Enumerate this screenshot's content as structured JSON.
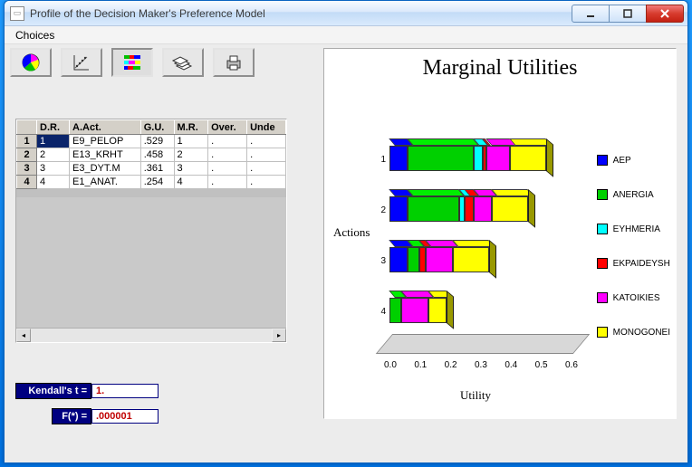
{
  "window": {
    "title": "Profile of the Decision Maker's Preference Model"
  },
  "menubar": {
    "choices": "Choices"
  },
  "toolbar": {
    "icons": [
      "pie-chart-icon",
      "scatter-icon",
      "stacked-bar-icon",
      "layers-icon",
      "print-icon"
    ]
  },
  "table": {
    "headers": [
      "D.R.",
      "A.Act.",
      "G.U.",
      "M.R.",
      "Over.",
      "Unde"
    ],
    "rows": [
      {
        "n": "1",
        "dr": "1",
        "act": "E9_PELOP",
        "gu": ".529",
        "mr": "1",
        "over": ".",
        "unde": "."
      },
      {
        "n": "2",
        "dr": "2",
        "act": "E13_KRHT",
        "gu": ".458",
        "mr": "2",
        "over": ".",
        "unde": "."
      },
      {
        "n": "3",
        "dr": "3",
        "act": "E3_DYT.M",
        "gu": ".361",
        "mr": "3",
        "over": ".",
        "unde": "."
      },
      {
        "n": "4",
        "dr": "4",
        "act": "E1_ANAT.",
        "gu": ".254",
        "mr": "4",
        "over": ".",
        "unde": "."
      }
    ]
  },
  "fields": {
    "kendall_label": "Kendall's t =",
    "kendall_value": "1.",
    "fstar_label": "F(*) =",
    "fstar_value": ".000001"
  },
  "chart_data": {
    "type": "bar",
    "orientation": "horizontal-stacked-3d",
    "title": "Marginal Utilities",
    "xlabel": "Utility",
    "ylabel": "Actions",
    "xlim": [
      0.0,
      0.6
    ],
    "xticks": [
      0.0,
      0.1,
      0.2,
      0.3,
      0.4,
      0.5,
      0.6
    ],
    "categories": [
      "1",
      "2",
      "3",
      "4"
    ],
    "series": [
      {
        "name": "AEP",
        "color": "#0000ff",
        "values": [
          0.06,
          0.06,
          0.06,
          0.0
        ]
      },
      {
        "name": "ANERGIA",
        "color": "#00d000",
        "values": [
          0.22,
          0.17,
          0.04,
          0.04
        ]
      },
      {
        "name": "EYHMERIA",
        "color": "#00ffff",
        "values": [
          0.03,
          0.02,
          0.0,
          0.0
        ]
      },
      {
        "name": "EKPAIDEYSH",
        "color": "#ff0000",
        "values": [
          0.01,
          0.03,
          0.02,
          0.0
        ]
      },
      {
        "name": "KATOIKIES",
        "color": "#ff00ff",
        "values": [
          0.08,
          0.06,
          0.09,
          0.09
        ]
      },
      {
        "name": "MONOGONEI",
        "color": "#ffff00",
        "values": [
          0.12,
          0.12,
          0.12,
          0.06
        ]
      }
    ]
  }
}
